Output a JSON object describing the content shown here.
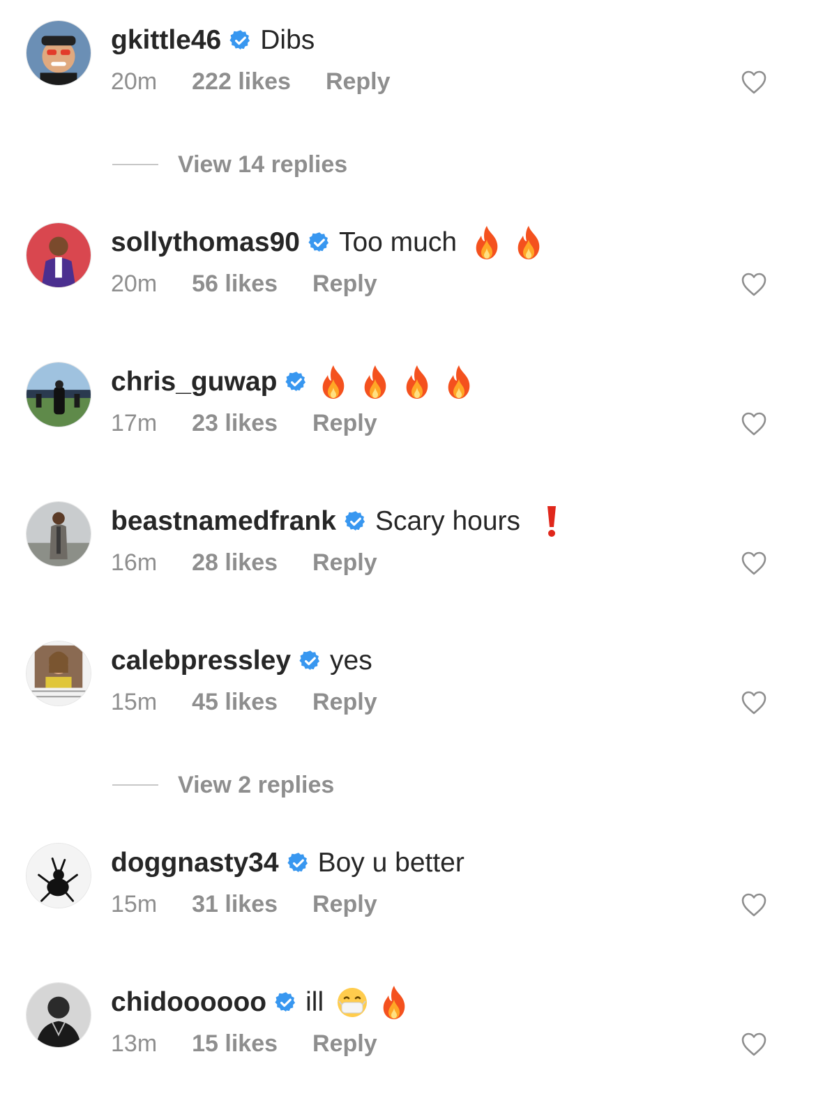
{
  "comments": [
    {
      "username": "gkittle46",
      "text": "Dibs",
      "emojis": [],
      "time": "20m",
      "likes": "222 likes",
      "reply": "Reply"
    },
    {
      "username": "sollythomas90",
      "text": "Too much",
      "emojis": [
        "fire",
        "fire"
      ],
      "time": "20m",
      "likes": "56 likes",
      "reply": "Reply"
    },
    {
      "username": "chris_guwap",
      "text": "",
      "emojis": [
        "fire",
        "fire",
        "fire",
        "fire"
      ],
      "time": "17m",
      "likes": "23 likes",
      "reply": "Reply"
    },
    {
      "username": "beastnamedfrank",
      "text": "Scary hours",
      "emojis": [
        "exclamation"
      ],
      "time": "16m",
      "likes": "28 likes",
      "reply": "Reply"
    },
    {
      "username": "calebpressley",
      "text": "yes",
      "emojis": [],
      "time": "15m",
      "likes": "45 likes",
      "reply": "Reply"
    },
    {
      "username": "doggnasty34",
      "text": "Boy u better",
      "emojis": [],
      "time": "15m",
      "likes": "31 likes",
      "reply": "Reply"
    },
    {
      "username": "chidoooooo",
      "text": "ill",
      "emojis": [
        "mask-face",
        "fire"
      ],
      "time": "13m",
      "likes": "15 likes",
      "reply": "Reply"
    }
  ],
  "view_replies": [
    {
      "label": "View 14 replies"
    },
    {
      "label": "View 2 replies"
    }
  ],
  "colors": {
    "text": "#262626",
    "secondary": "#8e8e8e",
    "verified": "#3897f0",
    "divider": "#c7c7c7"
  },
  "icons": {
    "verified": "verified-badge-icon",
    "heart": "heart-outline-icon"
  }
}
